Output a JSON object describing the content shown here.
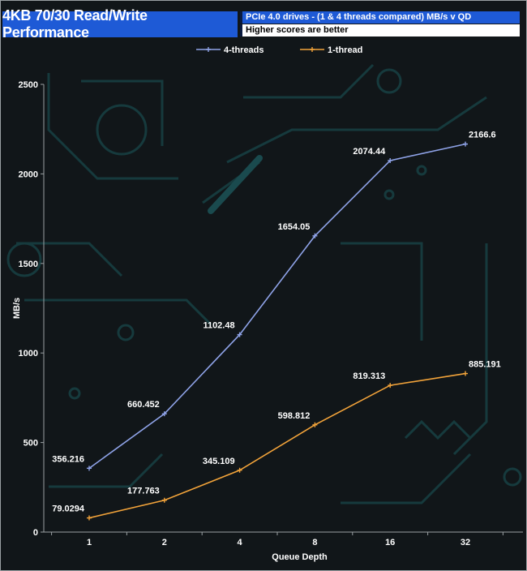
{
  "header": {
    "title": "4KB 70/30 Read/Write Performance",
    "subtitle": "PCIe 4.0 drives - (1 & 4 threads compared) MB/s v QD",
    "note": "Higher scores are better"
  },
  "colors": {
    "title_bg": "#1e5ad6",
    "series_4_threads": "#8fa3e8",
    "series_1_thread": "#f2a33a",
    "circuit": "#163a3d"
  },
  "chart_data": {
    "type": "line",
    "categories": [
      "1",
      "2",
      "4",
      "8",
      "16",
      "32"
    ],
    "series": [
      {
        "name": "4-threads",
        "values": [
          356.216,
          660.452,
          1102.48,
          1654.05,
          2074.44,
          2166.6
        ],
        "labels": [
          "356.216",
          "660.452",
          "1102.48",
          "1654.05",
          "2074.44",
          "2166.6"
        ]
      },
      {
        "name": "1-thread",
        "values": [
          79.0294,
          177.763,
          345.109,
          598.812,
          819.313,
          885.191
        ],
        "labels": [
          "79.0294",
          "177.763",
          "345.109",
          "598.812",
          "819.313",
          "885.191"
        ]
      }
    ],
    "xlabel": "Queue Depth",
    "ylabel": "MB/s",
    "ylim": [
      0,
      2500
    ],
    "yticks": [
      "0",
      "500",
      "1000",
      "1500",
      "2000",
      "2500"
    ],
    "grid": false,
    "legend": "top"
  }
}
